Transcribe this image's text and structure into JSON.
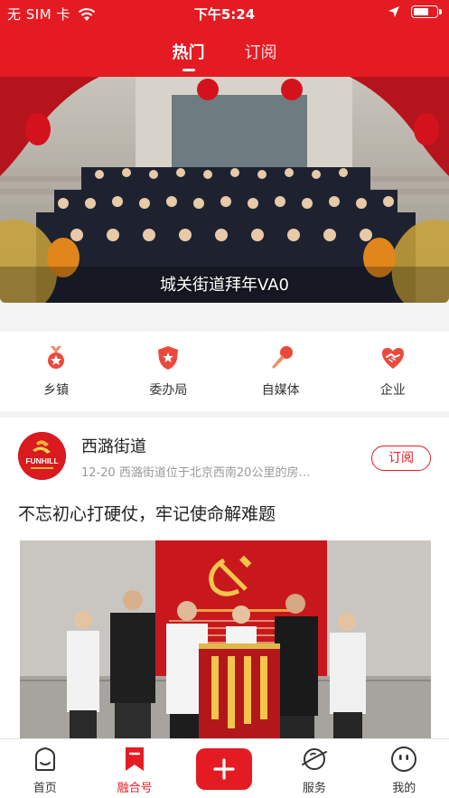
{
  "status_bar": {
    "carrier": "无 SIM 卡",
    "time": "下午5:24"
  },
  "top_tabs": [
    {
      "label": "热门",
      "active": true
    },
    {
      "label": "订阅",
      "active": false
    }
  ],
  "banner": {
    "caption": "城关街道拜年VA0"
  },
  "categories": [
    {
      "label": "乡镇",
      "icon": "medal-icon"
    },
    {
      "label": "委办局",
      "icon": "police-badge-icon"
    },
    {
      "label": "自媒体",
      "icon": "microphone-icon"
    },
    {
      "label": "企业",
      "icon": "handshake-icon"
    }
  ],
  "article": {
    "source_name": "西潞街道",
    "avatar_text": "FUNHILL",
    "meta": "12-20  西潞街道位于北京西南20公里的房…",
    "subscribe_label": "订阅",
    "title": "不忘初心打硬仗，牢记使命解难题"
  },
  "bottom_nav": [
    {
      "label": "首页",
      "icon": "home-icon",
      "active": false
    },
    {
      "label": "融合号",
      "icon": "bookmark-icon",
      "active": true
    },
    {
      "label": "",
      "icon": "plus-icon",
      "active": false
    },
    {
      "label": "服务",
      "icon": "planet-icon",
      "active": false
    },
    {
      "label": "我的",
      "icon": "smiley-icon",
      "active": false
    }
  ],
  "colors": {
    "brand": "#e51b23",
    "background": "#f3f3f3"
  }
}
